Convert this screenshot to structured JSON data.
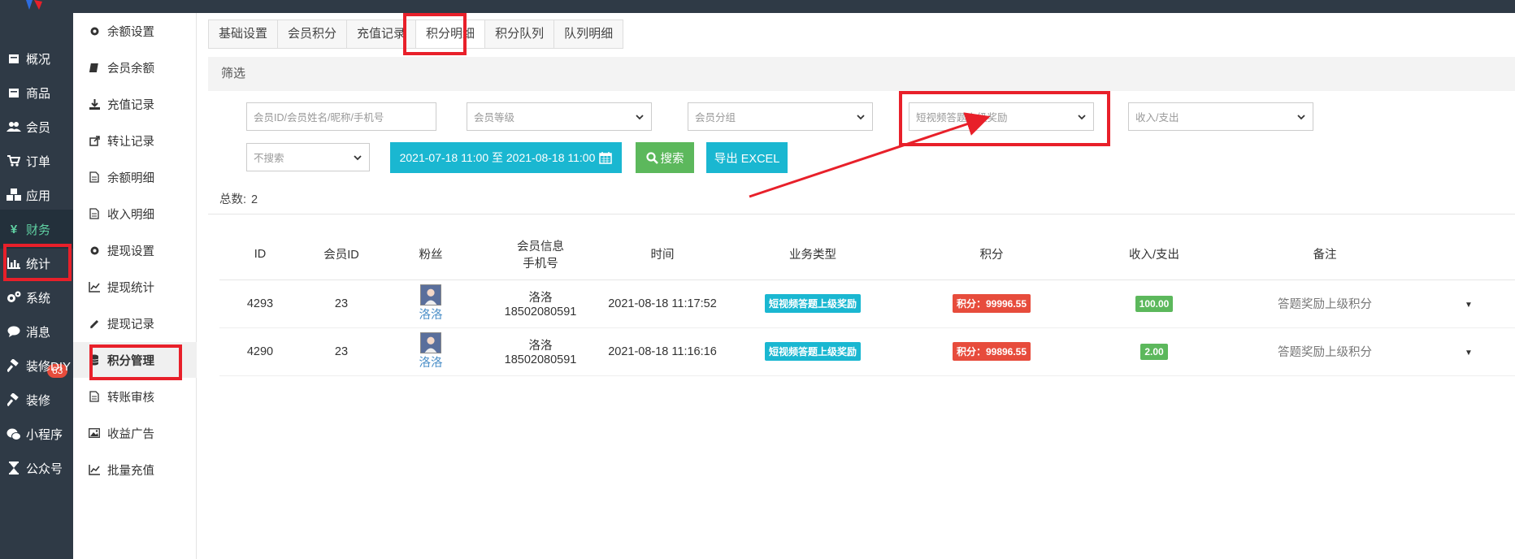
{
  "sidebar": {
    "items": [
      {
        "label": "概况",
        "icon": "square-icon"
      },
      {
        "label": "商品",
        "icon": "square-icon"
      },
      {
        "label": "会员",
        "icon": "users-icon"
      },
      {
        "label": "订单",
        "icon": "cart-icon"
      },
      {
        "label": "应用",
        "icon": "cubes-icon"
      },
      {
        "label": "财务",
        "icon": "yen-icon",
        "active": true
      },
      {
        "label": "统计",
        "icon": "bar-chart-icon"
      },
      {
        "label": "系统",
        "icon": "gears-icon"
      },
      {
        "label": "消息",
        "icon": "comment-icon"
      },
      {
        "label": "装修DIY",
        "icon": "hammer-icon"
      },
      {
        "label": "装修",
        "icon": "hammer-icon"
      },
      {
        "label": "小程序",
        "icon": "wechat-icon"
      },
      {
        "label": "公众号",
        "icon": "hourglass-icon"
      }
    ],
    "message_badge": "63"
  },
  "subbar": {
    "items": [
      {
        "label": "余额设置",
        "icon": "gear-icon"
      },
      {
        "label": "会员余额",
        "icon": "book-icon"
      },
      {
        "label": "充值记录",
        "icon": "download-icon"
      },
      {
        "label": "转让记录",
        "icon": "external-link-icon"
      },
      {
        "label": "余额明细",
        "icon": "file-icon"
      },
      {
        "label": "收入明细",
        "icon": "file-icon"
      },
      {
        "label": "提现设置",
        "icon": "gear-icon"
      },
      {
        "label": "提现统计",
        "icon": "line-chart-icon"
      },
      {
        "label": "提现记录",
        "icon": "pencil-icon"
      },
      {
        "label": "积分管理",
        "icon": "database-icon",
        "active": true
      },
      {
        "label": "转账审核",
        "icon": "file-icon"
      },
      {
        "label": "收益广告",
        "icon": "image-icon"
      },
      {
        "label": "批量充值",
        "icon": "line-chart-icon"
      }
    ]
  },
  "tabs": [
    "基础设置",
    "会员积分",
    "充值记录",
    "积分明细",
    "积分队列",
    "队列明细"
  ],
  "active_tab": "积分明细",
  "filter": {
    "title": "筛选",
    "search_placeholder": "会员ID/会员姓名/昵称/手机号",
    "level_select": "会员等级",
    "group_select": "会员分组",
    "type_select": "短视频答题上级奖励",
    "io_select": "收入/支出",
    "search_mode_select": "不搜索",
    "date_range": "2021-07-18 11:00 至 2021-08-18 11:00",
    "search_button": "搜索",
    "export_button": "导出 EXCEL"
  },
  "total": {
    "label": "总数:",
    "value": "2"
  },
  "table": {
    "headers": [
      "ID",
      "会员ID",
      "粉丝",
      "会员信息",
      "手机号",
      "时间",
      "业务类型",
      "积分",
      "收入/支出",
      "备注"
    ],
    "rows": [
      {
        "id": "4293",
        "member_id": "23",
        "fan": "洛洛",
        "info_name": "洛洛",
        "phone": "18502080591",
        "time": "2021-08-18 11:17:52",
        "type": "短视频答题上级奖励",
        "points": "积分：99996.55",
        "amount": "100.00",
        "remark": "答题奖励上级积分"
      },
      {
        "id": "4290",
        "member_id": "23",
        "fan": "洛洛",
        "info_name": "洛洛",
        "phone": "18502080591",
        "time": "2021-08-18 11:16:16",
        "type": "短视频答题上级奖励",
        "points": "积分：99896.55",
        "amount": "2.00",
        "remark": "答题奖励上级积分"
      }
    ]
  },
  "colors": {
    "annotation": "#e8202a",
    "sidebar_bg": "#2f3a46",
    "accent_cyan": "#1ab7d1",
    "accent_green": "#5cb85c",
    "accent_red": "#e74c3c"
  }
}
